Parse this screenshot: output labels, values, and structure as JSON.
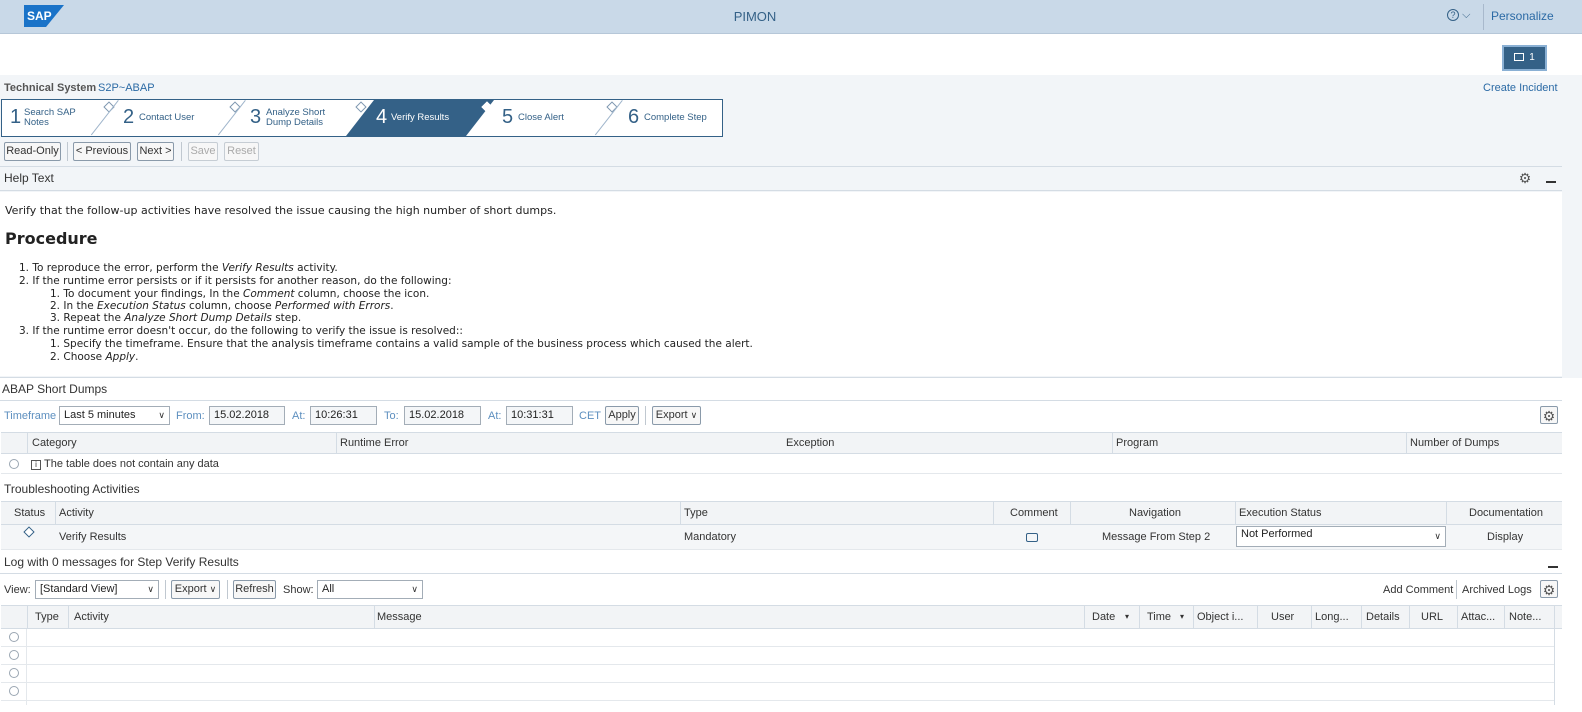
{
  "shell": {
    "logo": "SAP",
    "title": "PIMON",
    "help": "?",
    "help_chevron": "⌵",
    "personalize": "Personalize",
    "notification_count": "1"
  },
  "technical_system": {
    "label": "Technical System",
    "value": "S2P~ABAP"
  },
  "create_incident": "Create Incident",
  "roadmap": {
    "steps": [
      {
        "num": "1",
        "label_line1": "Search SAP",
        "label_line2": "Notes"
      },
      {
        "num": "2",
        "label_line1": "Contact User",
        "label_line2": ""
      },
      {
        "num": "3",
        "label_line1": "Analyze Short",
        "label_line2": "Dump Details"
      },
      {
        "num": "4",
        "label_line1": "Verify Results",
        "label_line2": ""
      },
      {
        "num": "5",
        "label_line1": "Close Alert",
        "label_line2": ""
      },
      {
        "num": "6",
        "label_line1": "Complete Step",
        "label_line2": ""
      }
    ],
    "active_step": 4
  },
  "toolbar": {
    "read_only": "Read-Only",
    "previous": "< Previous",
    "next": "Next >",
    "save": "Save",
    "reset": "Reset"
  },
  "help_text": {
    "title": "Help Text",
    "intro": "Verify that the follow-up activities have resolved the issue causing the high number of short dumps.",
    "procedure_title": "Procedure",
    "lines": [
      {
        "prefix": "1.",
        "pre": "To reproduce the error, perform the ",
        "em": "Verify Results",
        "post": " activity."
      },
      {
        "prefix": "2.",
        "pre": "If the runtime error persists or if it persists for another reason, do the following:",
        "em": "",
        "post": ""
      },
      {
        "prefix": "1.",
        "pre": "To document your findings, In the ",
        "em": "Comment",
        "post": " column, choose the icon."
      },
      {
        "prefix": "2.",
        "pre": "In the ",
        "em": "Execution Status",
        "post": " column, choose "
      },
      {
        "prefix": "3.",
        "pre": "Repeat the ",
        "em": "Analyze Short Dump Details",
        "post": " step."
      },
      {
        "prefix": "3.",
        "pre": "If the runtime error doesn't occur, do the following to verify the issue is resolved::",
        "em": "",
        "post": ""
      },
      {
        "prefix": "1.",
        "pre": "Specify the timeframe. Ensure that the analysis timeframe contains a valid sample of the business process which caused the alert.",
        "em": "",
        "post": ""
      },
      {
        "prefix": "2.",
        "pre": "Choose ",
        "em": "Apply",
        "post": "."
      }
    ],
    "line4_em2": "Performed with Errors",
    "line4_end": "."
  },
  "short_dumps": {
    "title": "ABAP Short Dumps",
    "timeframe_label": "Timeframe",
    "timeframe_value": "Last 5 minutes",
    "from_label": "From:",
    "from_date": "15.02.2018",
    "at_label": "At:",
    "from_time": "10:26:31",
    "to_label": "To:",
    "to_date": "15.02.2018",
    "at2_label": "At:",
    "to_time": "10:31:31",
    "tz": "CET",
    "apply": "Apply",
    "export": "Export",
    "columns": [
      "Category",
      "Runtime Error",
      "Exception",
      "Program",
      "Number of Dumps"
    ],
    "empty_text": "The table does not contain any data"
  },
  "troubleshooting": {
    "title": "Troubleshooting Activities",
    "columns": [
      "Status",
      "Activity",
      "Type",
      "Comment",
      "Navigation",
      "Execution Status",
      "Documentation"
    ],
    "rows": [
      {
        "activity": "Verify Results",
        "type": "Mandatory",
        "navigation": "Message From Step 2",
        "execution_status": "Not Performed",
        "documentation": "Display"
      }
    ]
  },
  "log": {
    "title": "Log with 0 messages for Step Verify Results",
    "view_label": "View:",
    "view_value": "[Standard View]",
    "export": "Export",
    "refresh": "Refresh",
    "show_label": "Show:",
    "show_value": "All",
    "add_comment": "Add Comment",
    "archived_logs": "Archived Logs",
    "columns": [
      "Type",
      "Activity",
      "Message",
      "Date",
      "Time",
      "Object i...",
      "User",
      "Long...",
      "Details",
      "URL",
      "Attac...",
      "Note..."
    ]
  }
}
